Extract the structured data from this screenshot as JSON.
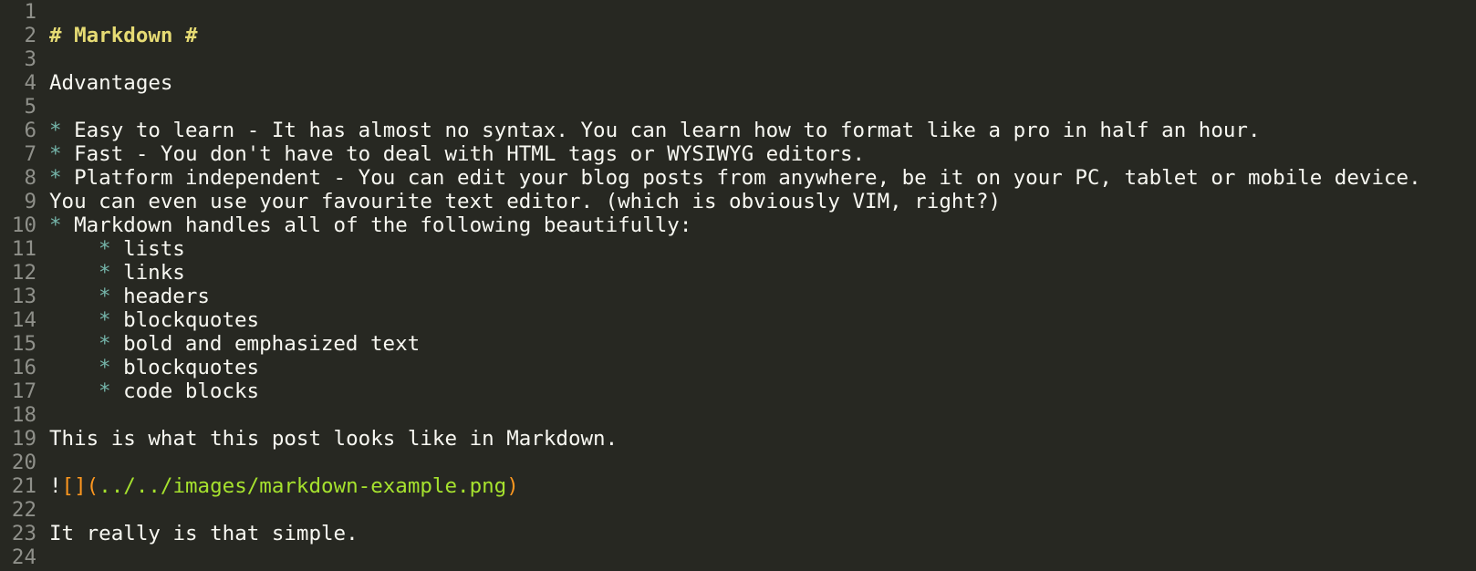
{
  "editor": {
    "line_numbers": [
      "1",
      "2",
      "3",
      "4",
      "5",
      "6",
      "7",
      "8",
      "9",
      "10",
      "11",
      "12",
      "13",
      "14",
      "15",
      "16",
      "17",
      "18",
      "19",
      "20",
      "21",
      "22",
      "23",
      "24"
    ],
    "heading": "# Markdown #",
    "advantages": "Advantages",
    "bullet_glyph": "*",
    "items": {
      "easy": " Easy to learn - It has almost no syntax. You can learn how to format like a pro in half an hour.",
      "fast": " Fast - You don't have to deal with HTML tags or WYSIWYG editors.",
      "platform": " Platform independent - You can edit your blog posts from anywhere, be it on your PC, tablet or mobile device.",
      "platform_cont": "You can even use your favourite text editor. (which is obviously VIM, right?)",
      "handles": " Markdown handles all of the following beautifully:"
    },
    "subitems": [
      " lists",
      " links",
      " headers",
      " blockquotes",
      " bold and emphasized text",
      " blockquotes",
      " code blocks"
    ],
    "post_line": "This is what this post looks like in Markdown.",
    "image": {
      "bang": "!",
      "alt_brackets": "[]",
      "open_paren": "(",
      "url": "../../images/markdown-example.png",
      "close_paren": ")"
    },
    "simple_line": "It really is that simple."
  },
  "colors": {
    "background": "#272822",
    "text": "#f8f8f2",
    "line_number": "#8f908a",
    "heading": "#e6db74",
    "bullet": "#75b5aa",
    "bracket": "#fd971f",
    "url": "#a6e22e"
  }
}
